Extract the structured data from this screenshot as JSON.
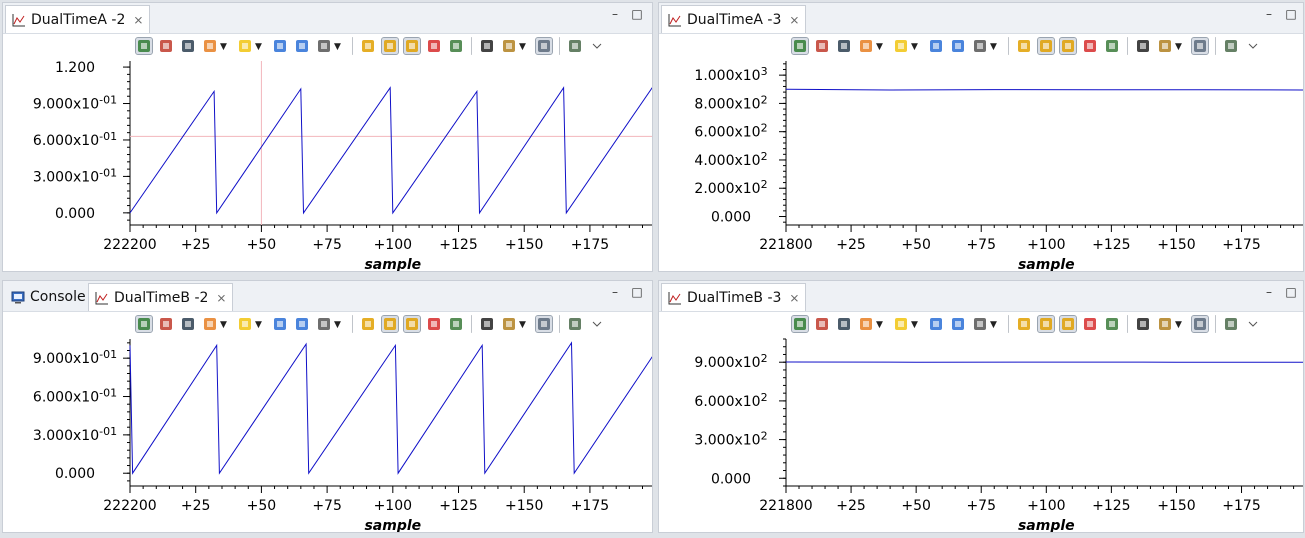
{
  "panels": {
    "a2": {
      "tabs": [
        {
          "label": "DualTimeA -2",
          "close": "⨯",
          "icon": "graph-icon",
          "active": true
        }
      ],
      "buttons": {
        "minimize": "–",
        "maximize": "□"
      },
      "y_ticks": [
        "1.200",
        "9.000x10-01",
        "6.000x10-01",
        "3.000x10-01",
        "0.000"
      ],
      "x_ticks": [
        "222200",
        "+25",
        "+50",
        "+75",
        "+100",
        "+125",
        "+150",
        "+175"
      ],
      "x_title": "sample"
    },
    "a3": {
      "tabs": [
        {
          "label": "DualTimeA -3",
          "close": "⨯",
          "icon": "graph-icon",
          "active": true
        }
      ],
      "buttons": {
        "minimize": "–",
        "maximize": "□"
      },
      "y_ticks": [
        "1.000x103",
        "8.000x102",
        "6.000x102",
        "4.000x102",
        "2.000x102",
        "0.000"
      ],
      "x_ticks": [
        "221800",
        "+25",
        "+50",
        "+75",
        "+100",
        "+125",
        "+150",
        "+175"
      ],
      "x_title": "sample"
    },
    "b2": {
      "tabs": [
        {
          "label": "Console",
          "icon": "console-icon",
          "active": false
        },
        {
          "label": "DualTimeB -2",
          "close": "⨯",
          "icon": "graph-icon",
          "active": true
        }
      ],
      "buttons": {
        "minimize": "–",
        "maximize": "□"
      },
      "y_ticks": [
        "9.000x10-01",
        "6.000x10-01",
        "3.000x10-01",
        "0.000"
      ],
      "x_ticks": [
        "222200",
        "+25",
        "+50",
        "+75",
        "+100",
        "+125",
        "+150",
        "+175"
      ],
      "x_title": "sample"
    },
    "b3": {
      "tabs": [
        {
          "label": "DualTimeB -3",
          "close": "⨯",
          "icon": "graph-icon",
          "active": true
        }
      ],
      "buttons": {
        "minimize": "–",
        "maximize": "□"
      },
      "y_ticks": [
        "9.000x102",
        "6.000x102",
        "3.000x102",
        "0.000"
      ],
      "x_ticks": [
        "221800",
        "+25",
        "+50",
        "+75",
        "+100",
        "+125",
        "+150",
        "+175"
      ],
      "x_title": "sample"
    }
  },
  "toolbar_icons": [
    "show-data-icon",
    "cursor-icon",
    "legend-icon",
    "marker-icon",
    "highlight-icon",
    "zoom-in-icon",
    "zoom-out-icon",
    "zoom-fit-icon",
    "refresh-icon",
    "sync-icon",
    "sync-all-icon",
    "remove-icon",
    "export-icon",
    "find-icon",
    "settings-icon",
    "lock-icon",
    "menu-icon",
    "view-menu-icon"
  ],
  "colors": {
    "trace": "#1010c8",
    "cursor": "#f2b6bc",
    "axis": "#000000"
  },
  "chart_data": [
    {
      "type": "line",
      "panel": "DualTimeA -2",
      "x_title": "sample",
      "x_origin_label": "222200",
      "xlim": [
        0,
        199
      ],
      "ylim": [
        -0.1,
        1.25
      ],
      "series": [
        {
          "x": [
            0,
            32,
            33,
            65,
            66,
            99,
            100,
            132,
            133,
            165,
            166,
            199,
            200
          ],
          "values": [
            0.0,
            1.0,
            0.0,
            1.02,
            0.0,
            1.03,
            0.0,
            1.0,
            0.0,
            1.03,
            0.0,
            1.04,
            0.18
          ]
        }
      ],
      "cursor": {
        "x": 50,
        "y": 0.63
      }
    },
    {
      "type": "line",
      "panel": "DualTimeA -3",
      "x_title": "sample",
      "x_origin_label": "221800",
      "xlim": [
        0,
        199
      ],
      "ylim": [
        -60,
        1100
      ],
      "series": [
        {
          "x": [
            0,
            40,
            80,
            120,
            160,
            199
          ],
          "values": [
            900,
            895,
            898,
            896,
            897,
            895
          ]
        }
      ]
    },
    {
      "type": "line",
      "panel": "DualTimeB -2",
      "x_title": "sample",
      "x_origin_label": "222200",
      "xlim": [
        0,
        199
      ],
      "ylim": [
        -0.1,
        1.05
      ],
      "series": [
        {
          "x": [
            0,
            1,
            33,
            34,
            67,
            68,
            101,
            102,
            134,
            135,
            168,
            169,
            199
          ],
          "values": [
            1.0,
            0.0,
            1.0,
            0.0,
            1.01,
            0.0,
            1.0,
            0.0,
            1.0,
            0.0,
            1.02,
            0.0,
            0.92
          ]
        }
      ]
    },
    {
      "type": "line",
      "panel": "DualTimeB -3",
      "x_title": "sample",
      "x_origin_label": "221800",
      "xlim": [
        0,
        199
      ],
      "ylim": [
        -60,
        1080
      ],
      "series": [
        {
          "x": [
            0,
            50,
            100,
            150,
            199
          ],
          "values": [
            902,
            900,
            901,
            900,
            899
          ]
        }
      ]
    }
  ]
}
